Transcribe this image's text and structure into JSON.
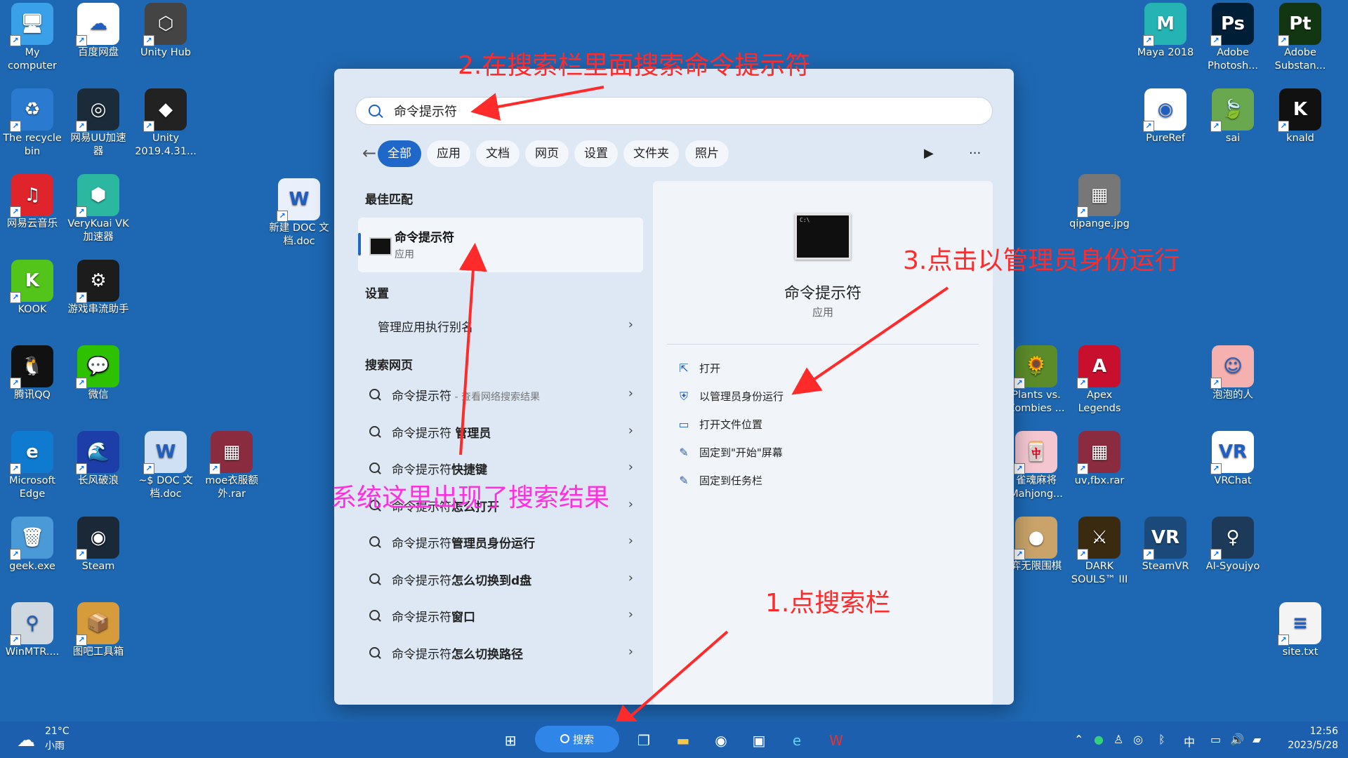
{
  "desktop": {
    "icons_left": [
      {
        "label": "My\ncomputer",
        "color": "#3aa0e8",
        "glyph": "🖥"
      },
      {
        "label": "百度网盘",
        "color": "#ffffff",
        "glyph": "☁"
      },
      {
        "label": "Unity Hub",
        "color": "#444444",
        "glyph": "⬡"
      },
      {
        "label": "The recycle\nbin",
        "color": "#2a7ad0",
        "glyph": "♻"
      },
      {
        "label": "网易UU加速\n器",
        "color": "#1b2b3a",
        "glyph": "◎"
      },
      {
        "label": "Unity\n2019.4.31...",
        "color": "#222222",
        "glyph": "◆"
      },
      {
        "label": "网易云音乐",
        "color": "#e0242c",
        "glyph": "♫"
      },
      {
        "label": "VeryKuai VK\n加速器",
        "color": "#2bb7a0",
        "glyph": "⬢"
      },
      {
        "label": "新建 DOC 文\n档.doc",
        "color": "#e9f0fb",
        "glyph": "W"
      },
      {
        "label": "KOOK",
        "color": "#52c41a",
        "glyph": "K"
      },
      {
        "label": "游戏串流助手",
        "color": "#1c1c1c",
        "glyph": "⚙"
      },
      {
        "label": "腾讯QQ",
        "color": "#111111",
        "glyph": "🐧"
      },
      {
        "label": "微信",
        "color": "#2dc100",
        "glyph": "💬"
      },
      {
        "label": "Microsoft\nEdge",
        "color": "#0f7bd0",
        "glyph": "e"
      },
      {
        "label": "长风破浪",
        "color": "#1d3ea8",
        "glyph": "🌊"
      },
      {
        "label": "~$ DOC 文\n档.doc",
        "color": "#cfdff4",
        "glyph": "W"
      },
      {
        "label": "moe衣服额\n外.rar",
        "color": "#8b2b3f",
        "glyph": "▦"
      },
      {
        "label": "geek.exe",
        "color": "#4a9ad8",
        "glyph": "🗑"
      },
      {
        "label": "Steam",
        "color": "#1b2838",
        "glyph": "◉"
      },
      {
        "label": "WinMTR....",
        "color": "#cfd8e0",
        "glyph": "⚲"
      },
      {
        "label": "图吧工具箱",
        "color": "#d69b3a",
        "glyph": "📦"
      }
    ],
    "icons_right": [
      {
        "label": "Maya 2018",
        "color": "#26b3b3",
        "glyph": "M"
      },
      {
        "label": "Adobe\nPhotosh...",
        "color": "#001e36",
        "glyph": "Ps"
      },
      {
        "label": "Adobe\nSubstan...",
        "color": "#133612",
        "glyph": "Pt"
      },
      {
        "label": "PureRef",
        "color": "#ffffff",
        "glyph": "◉"
      },
      {
        "label": "sai",
        "color": "#6aa84f",
        "glyph": "🍃"
      },
      {
        "label": "knald",
        "color": "#111111",
        "glyph": "K"
      },
      {
        "label": "qipange.jpg",
        "color": "#777777",
        "glyph": "▦"
      },
      {
        "label": "Plants vs.\nZombies ...",
        "color": "#5c8c2a",
        "glyph": "🌻"
      },
      {
        "label": "Apex\nLegends",
        "color": "#c8102e",
        "glyph": "A"
      },
      {
        "label": "泡泡的人",
        "color": "#f5b0b0",
        "glyph": "☺"
      },
      {
        "label": "雀魂麻将\nMahjong...",
        "color": "#f3c6d0",
        "glyph": "🀄"
      },
      {
        "label": "uv,fbx.rar",
        "color": "#8b2b3f",
        "glyph": "▦"
      },
      {
        "label": "VRChat",
        "color": "#ffffff",
        "glyph": "VR"
      },
      {
        "label": "弈无限围棋",
        "color": "#c9a36a",
        "glyph": "●"
      },
      {
        "label": "DARK\nSOULS™ III",
        "color": "#3a2a10",
        "glyph": "⚔"
      },
      {
        "label": "SteamVR",
        "color": "#1b4a7a",
        "glyph": "VR"
      },
      {
        "label": "AI-Syoujyo",
        "color": "#1d3a5a",
        "glyph": "♀"
      },
      {
        "label": "site.txt",
        "color": "#f4f4f4",
        "glyph": "≡"
      }
    ]
  },
  "start": {
    "search_value": "命令提示符",
    "filters": [
      "全部",
      "应用",
      "文档",
      "网页",
      "设置",
      "文件夹",
      "照片"
    ],
    "best_match_heading": "最佳匹配",
    "best_match": {
      "title": "命令提示符",
      "subtitle": "应用"
    },
    "settings_heading": "设置",
    "settings_item": "管理应用执行别名",
    "web_heading": "搜索网页",
    "web_results": [
      {
        "base": "命令提示符",
        "bold": "",
        "small": " - 查看网络搜索结果"
      },
      {
        "base": "命令提示符 ",
        "bold": "管理员",
        "small": ""
      },
      {
        "base": "命令提示符",
        "bold": "快捷键",
        "small": ""
      },
      {
        "base": "命令提示符",
        "bold": "怎么打开",
        "small": ""
      },
      {
        "base": "命令提示符",
        "bold": "管理员身份运行",
        "small": ""
      },
      {
        "base": "命令提示符",
        "bold": "怎么切换到d盘",
        "small": ""
      },
      {
        "base": "命令提示符",
        "bold": "窗口",
        "small": ""
      },
      {
        "base": "命令提示符",
        "bold": "怎么切换路径",
        "small": ""
      }
    ],
    "detail": {
      "name": "命令提示符",
      "type": "应用",
      "actions": [
        "打开",
        "以管理员身份运行",
        "打开文件位置",
        "固定到\"开始\"屏幕",
        "固定到任务栏"
      ]
    }
  },
  "annotations": {
    "step1": "1.点搜索栏",
    "step2": "2.在搜索栏里面搜索命令提示符",
    "step3": "3.点击以管理员身份运行",
    "result_note": "系统这里出现了搜索结果"
  },
  "taskbar": {
    "weather_temp": "21°C",
    "weather_desc": "小雨",
    "search_label": "搜索",
    "ime": "中",
    "time": "12:56",
    "date": "2023/5/28"
  }
}
